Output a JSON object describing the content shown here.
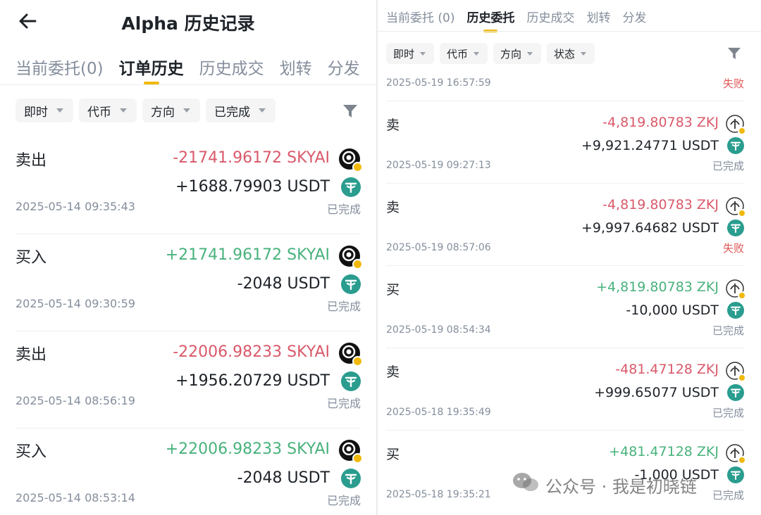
{
  "left": {
    "title": "Alpha 历史记录",
    "tabs": [
      {
        "label": "当前委托(0)",
        "active": false
      },
      {
        "label": "订单历史",
        "active": true
      },
      {
        "label": "历史成交",
        "active": false
      },
      {
        "label": "划转",
        "active": false
      },
      {
        "label": "分发",
        "active": false
      }
    ],
    "filters": [
      "即时",
      "代币",
      "方向",
      "已完成"
    ],
    "orders": [
      {
        "side": "卖出",
        "amount": "-21741.96172 SKYAI",
        "usdt": "+1688.79903 USDT",
        "time": "2025-05-14 09:35:43",
        "status": "已完成"
      },
      {
        "side": "买入",
        "amount": "+21741.96172 SKYAI",
        "usdt": "-2048 USDT",
        "time": "2025-05-14 09:30:59",
        "status": "已完成"
      },
      {
        "side": "卖出",
        "amount": "-22006.98233 SKYAI",
        "usdt": "+1956.20729 USDT",
        "time": "2025-05-14 08:56:19",
        "status": "已完成"
      },
      {
        "side": "买入",
        "amount": "+22006.98233 SKYAI",
        "usdt": "-2048 USDT",
        "time": "2025-05-14 08:53:14",
        "status": "已完成"
      }
    ]
  },
  "right": {
    "tabs": [
      {
        "label": "当前委托 (0)",
        "active": false
      },
      {
        "label": "历史委托",
        "active": true
      },
      {
        "label": "历史成交",
        "active": false
      },
      {
        "label": "划转",
        "active": false
      },
      {
        "label": "分发",
        "active": false
      }
    ],
    "filters": [
      "即时",
      "代币",
      "方向",
      "状态"
    ],
    "top_row": {
      "time": "2025-05-19 16:57:59",
      "status": "失败"
    },
    "orders": [
      {
        "side": "卖",
        "amount": "-4,819.80783 ZKJ",
        "usdt": "+9,921.24771 USDT",
        "time": "2025-05-19 09:27:13",
        "status": "已完成"
      },
      {
        "side": "卖",
        "amount": "-4,819.80783 ZKJ",
        "usdt": "+9,997.64682 USDT",
        "time": "2025-05-19 08:57:06",
        "status": "失败"
      },
      {
        "side": "买",
        "amount": "+4,819.80783 ZKJ",
        "usdt": "-10,000 USDT",
        "time": "2025-05-19 08:54:34",
        "status": "已完成"
      },
      {
        "side": "卖",
        "amount": "-481.47128 ZKJ",
        "usdt": "+999.65077 USDT",
        "time": "2025-05-18 19:35:49",
        "status": "已完成"
      },
      {
        "side": "买",
        "amount": "+481.47128 ZKJ",
        "usdt": "-1,000 USDT",
        "time": "2025-05-18 19:35:21",
        "status": "已完成"
      }
    ]
  },
  "watermark": {
    "text": "公众号 · 我是初晓链"
  },
  "colors": {
    "accent": "#f0b90b",
    "sell": "#d9596a",
    "buy": "#48b27c",
    "fail": "#e25555",
    "usdt": "#2a9d8f"
  },
  "icons": {
    "back": "back-arrow-icon",
    "filter": "filter-funnel-icon",
    "coin": "token-logo-icon",
    "usdt": "usdt-icon",
    "wechat": "wechat-icon"
  }
}
